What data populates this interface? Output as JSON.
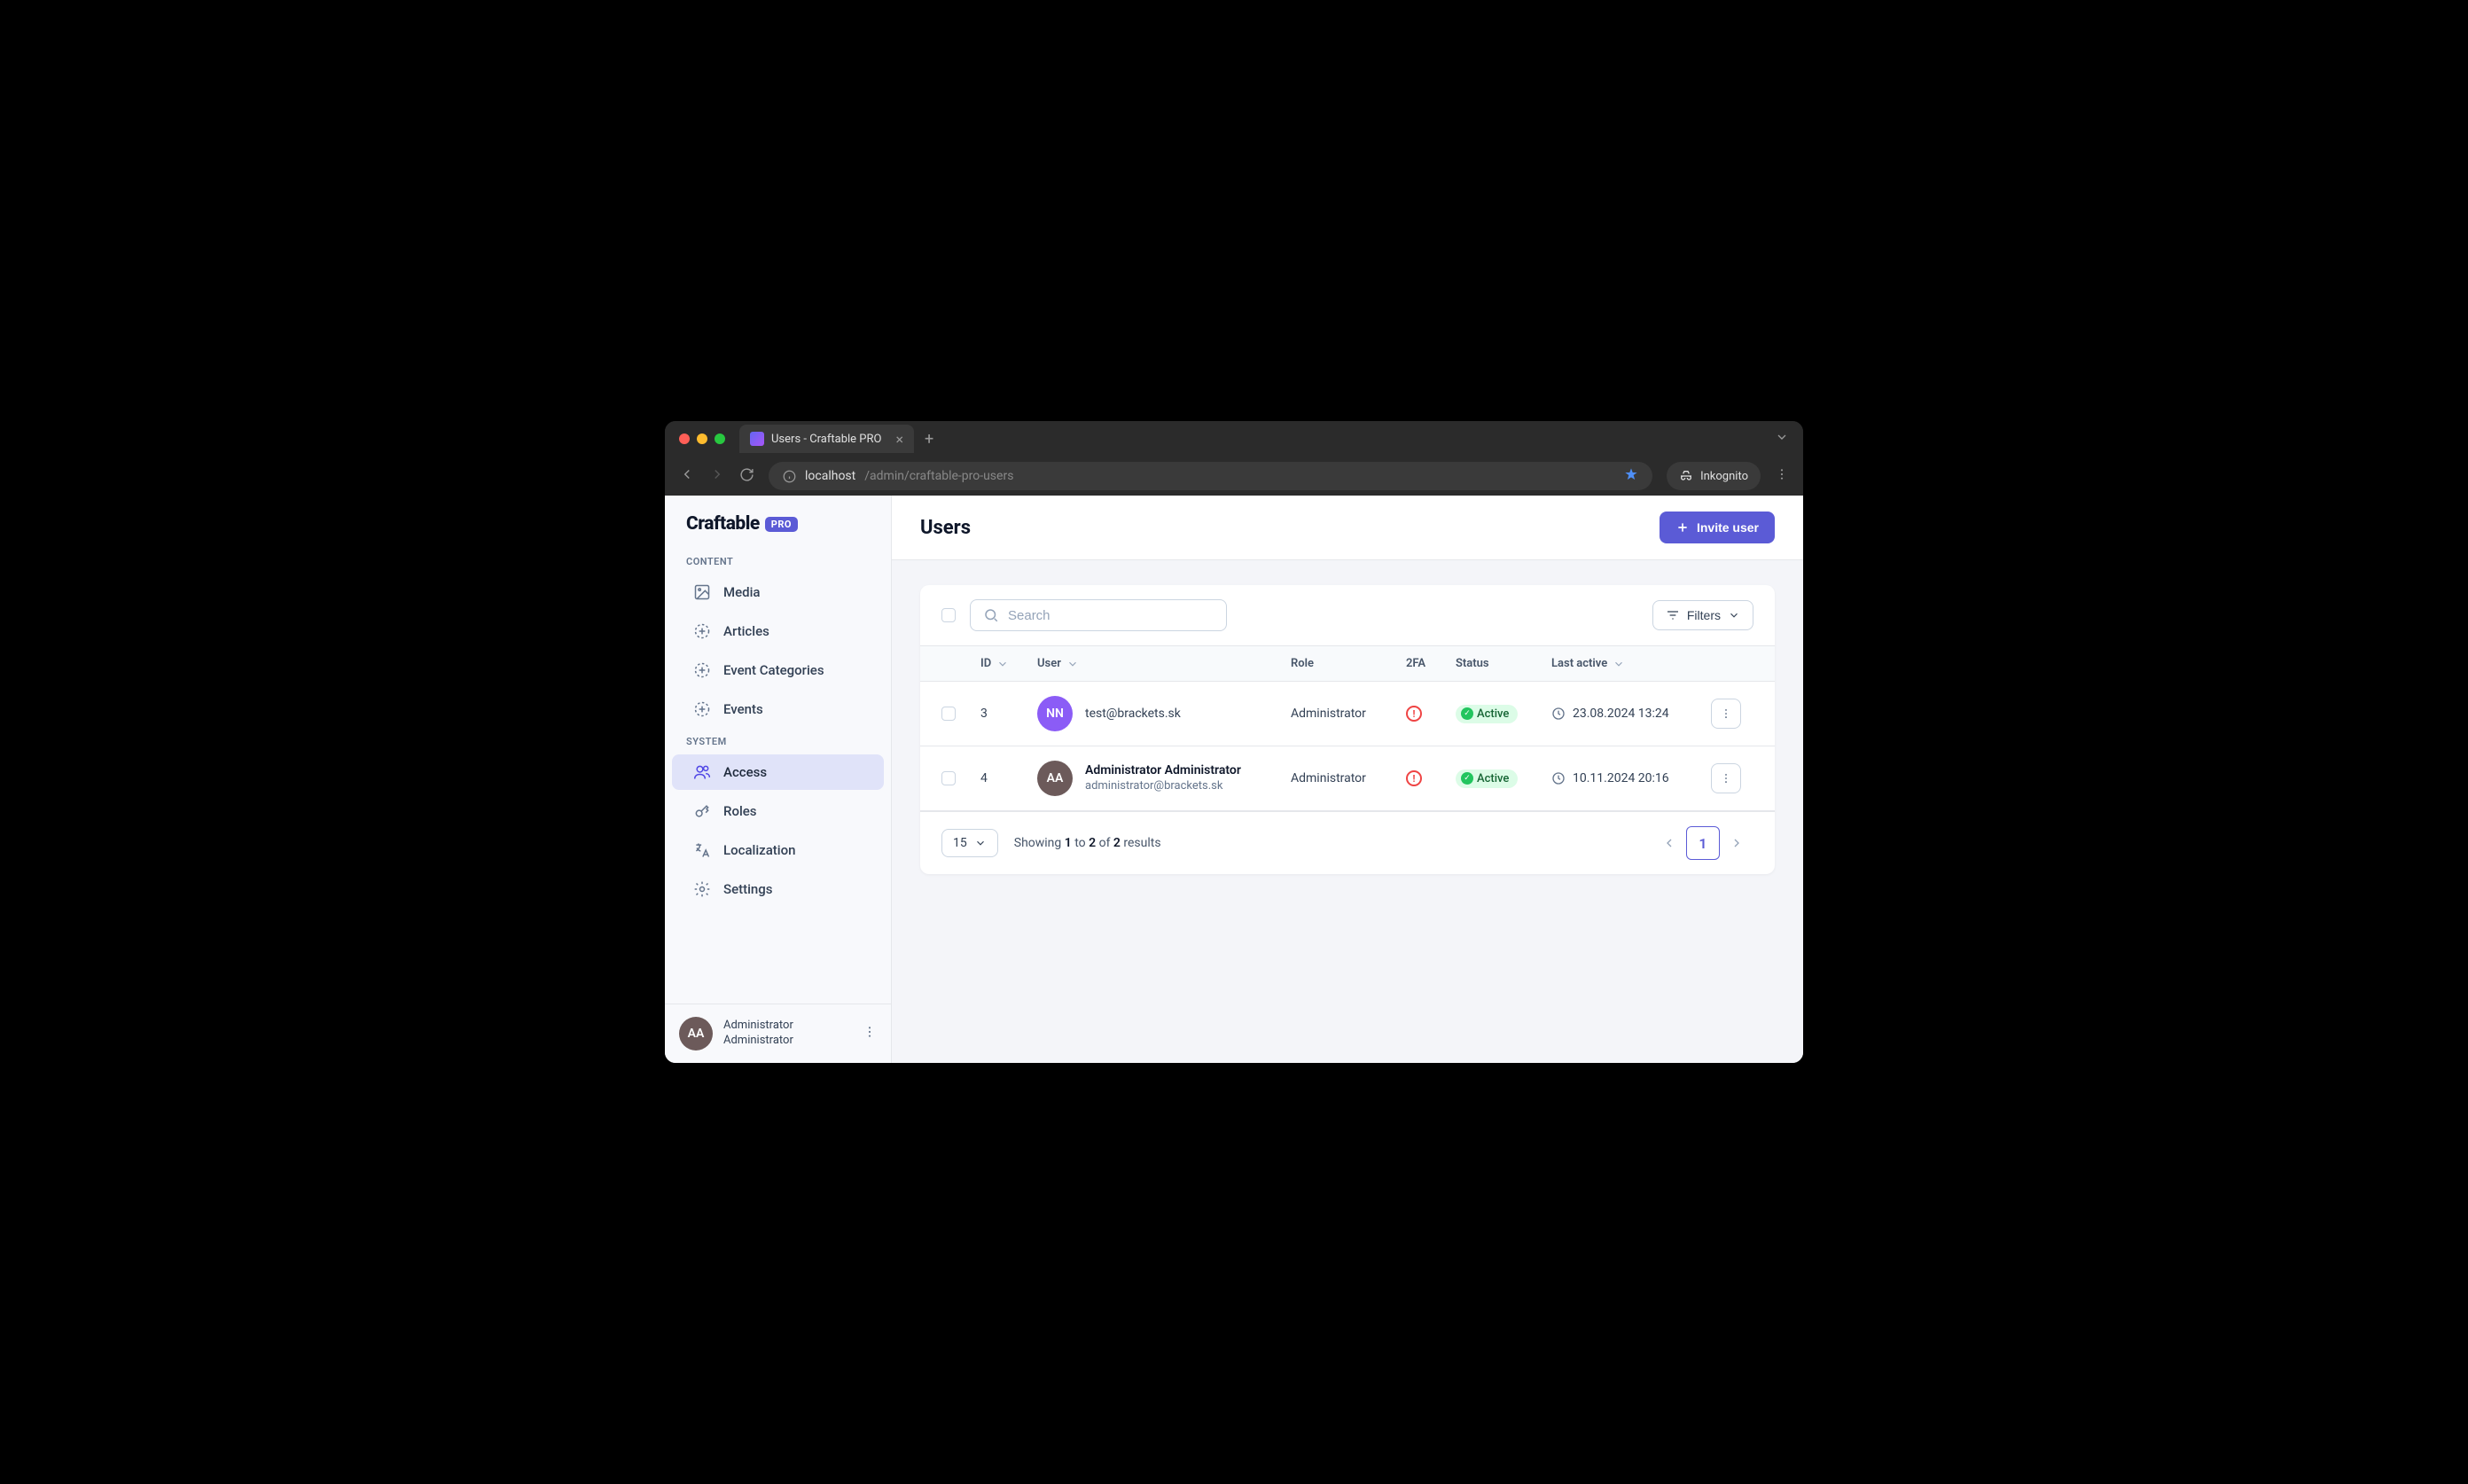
{
  "browser": {
    "tab_title": "Users - Craftable PRO",
    "url_host": "localhost",
    "url_path": "/admin/craftable-pro-users",
    "incognito_label": "Inkognito"
  },
  "logo": {
    "text": "Craftable",
    "badge": "PRO"
  },
  "sidebar": {
    "section_content": "CONTENT",
    "section_system": "SYSTEM",
    "items_content": [
      {
        "label": "Media"
      },
      {
        "label": "Articles"
      },
      {
        "label": "Event Categories"
      },
      {
        "label": "Events"
      }
    ],
    "items_system": [
      {
        "label": "Access"
      },
      {
        "label": "Roles"
      },
      {
        "label": "Localization"
      },
      {
        "label": "Settings"
      }
    ],
    "footer_user": {
      "line1": "Administrator",
      "line2": "Administrator",
      "initials": "AA"
    }
  },
  "page": {
    "title": "Users",
    "invite_label": "Invite user",
    "search_placeholder": "Search",
    "filters_label": "Filters"
  },
  "table": {
    "headers": {
      "id": "ID",
      "user": "User",
      "role": "Role",
      "twofa": "2FA",
      "status": "Status",
      "last_active": "Last active"
    },
    "rows": [
      {
        "id": "3",
        "initials": "NN",
        "avatar_class": "av-purple",
        "name": "",
        "email": "test@brackets.sk",
        "role": "Administrator",
        "status": "Active",
        "last_active": "23.08.2024 13:24"
      },
      {
        "id": "4",
        "initials": "AA",
        "avatar_class": "av-brown",
        "name": "Administrator Administrator",
        "email": "administrator@brackets.sk",
        "role": "Administrator",
        "status": "Active",
        "last_active": "10.11.2024 20:16"
      }
    ]
  },
  "footer": {
    "per_page": "15",
    "results_prefix": "Showing ",
    "results_from": "1",
    "results_to_word": " to ",
    "results_to": "2",
    "results_of_word": " of ",
    "results_total": "2",
    "results_suffix": " results",
    "current_page": "1"
  }
}
